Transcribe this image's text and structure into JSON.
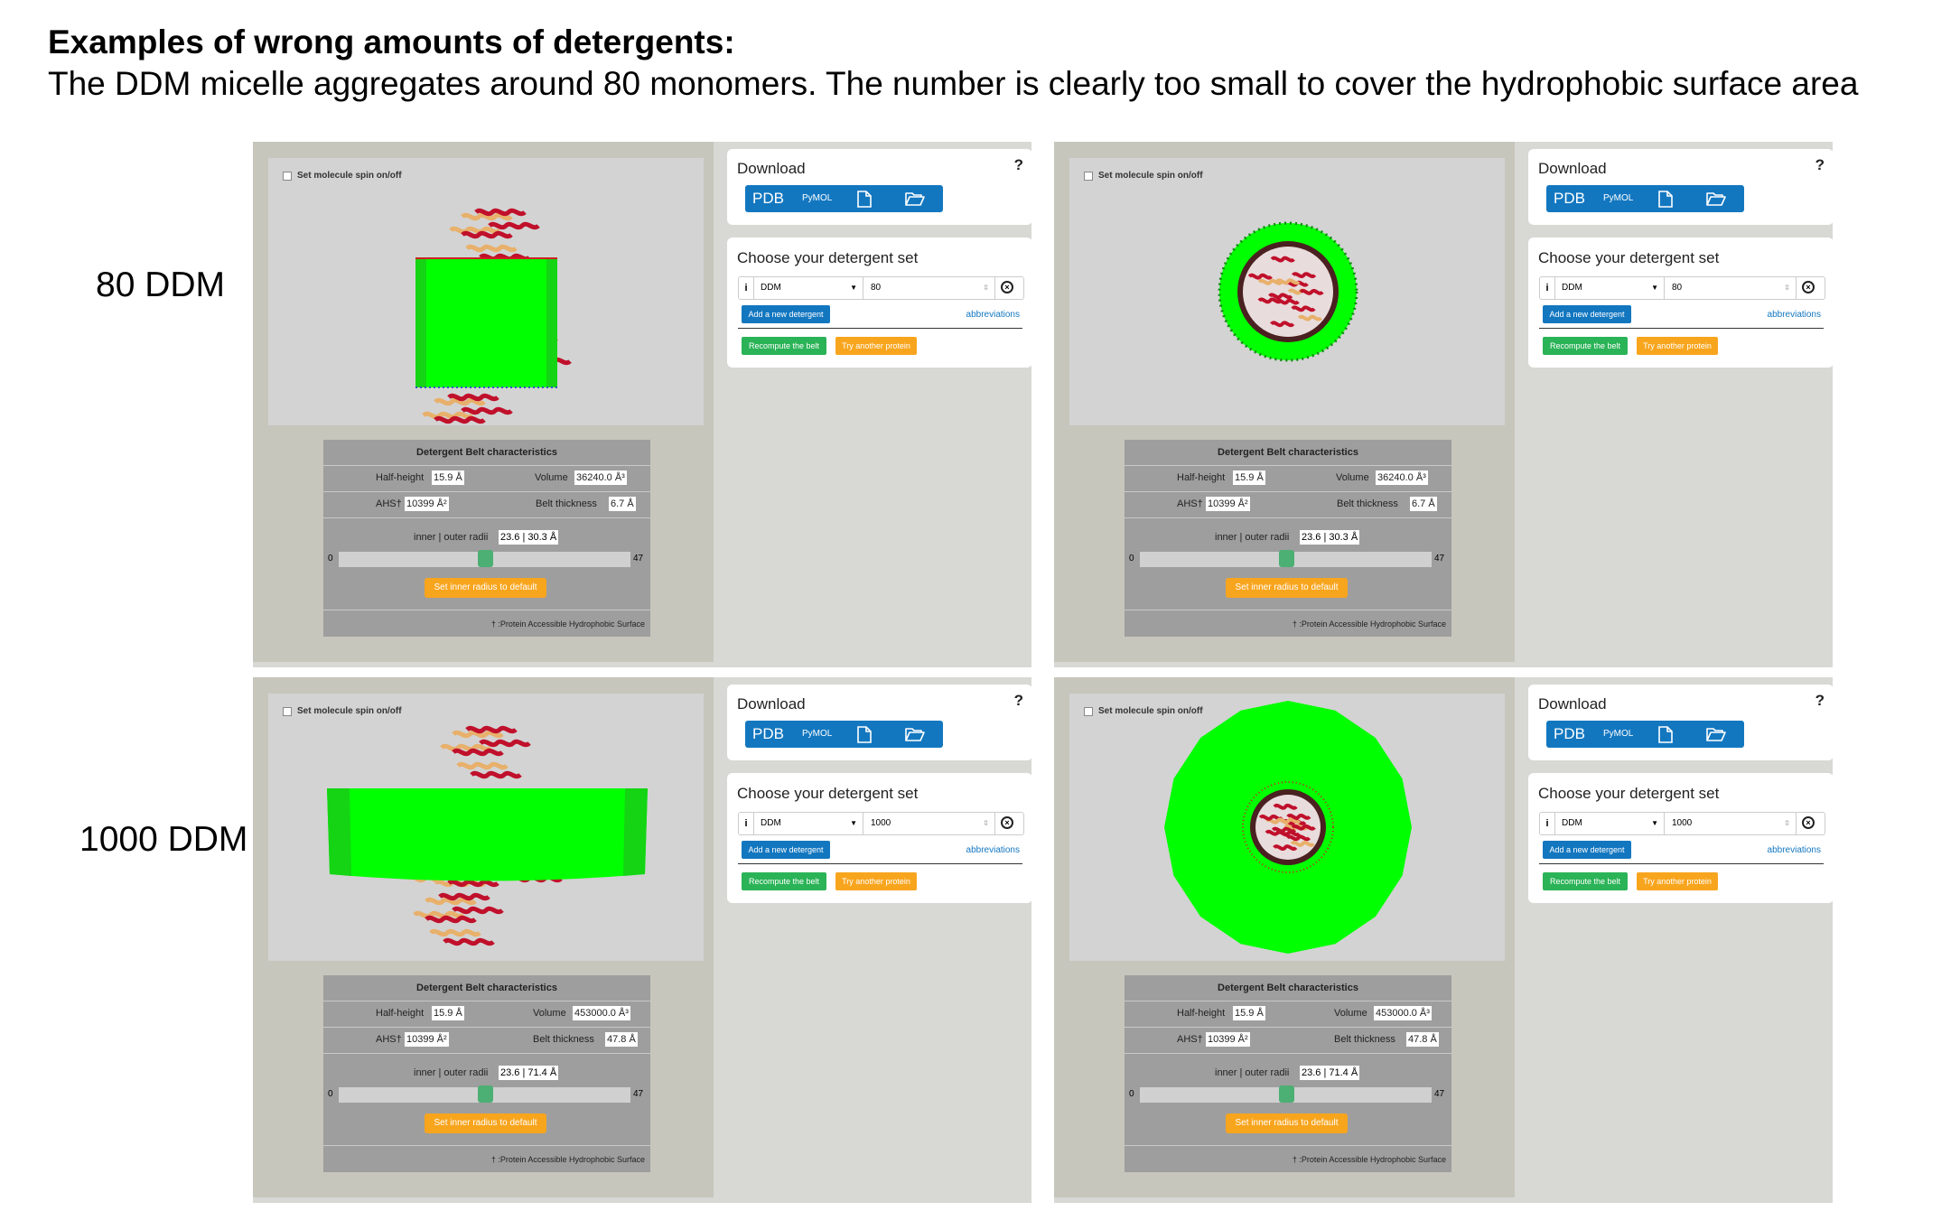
{
  "heading": "Examples of wrong amounts of detergents:",
  "subheading": "The DDM micelle aggregates around 80 monomers. The number is clearly too small to cover the hydrophobic surface area",
  "rows": [
    {
      "label": "80 DDM",
      "panels": [
        {
          "view": "side",
          "spin_label": "Set molecule spin on/off",
          "characteristics": {
            "title": "Detergent Belt characteristics",
            "half_height_label": "Half-height",
            "half_height": "15.9 Å",
            "volume_label": "Volume",
            "volume": "36240.0 Å³",
            "ahs_label": "AHS†",
            "ahs": "10399 Å²",
            "belt_thickness_label": "Belt thickness",
            "belt_thickness": "6.7 Å",
            "radii_label": "inner | outer radii",
            "radii": "23.6 | 30.3 Å",
            "slider_min": "0",
            "slider_max": "47",
            "slider_value": 23.6,
            "reset_label": "Set inner radius to default",
            "footnote": "† :Protein Accessible Hydrophobic Surface"
          },
          "download": {
            "title": "Download",
            "help": "?",
            "pdb": "PDB",
            "pymol": "PyMOL"
          },
          "choose": {
            "title": "Choose your detergent set",
            "info": "i",
            "detergent": "DDM",
            "amount": "80",
            "add_label": "Add a new detergent",
            "abbreviations": "abbreviations",
            "recompute_label": "Recompute the belt",
            "try_label": "Try another protein"
          }
        },
        {
          "view": "top",
          "spin_label": "Set molecule spin on/off",
          "characteristics": {
            "title": "Detergent Belt characteristics",
            "half_height_label": "Half-height",
            "half_height": "15.9 Å",
            "volume_label": "Volume",
            "volume": "36240.0 Å³",
            "ahs_label": "AHS†",
            "ahs": "10399 Å²",
            "belt_thickness_label": "Belt thickness",
            "belt_thickness": "6.7 Å",
            "radii_label": "inner | outer radii",
            "radii": "23.6 | 30.3 Å",
            "slider_min": "0",
            "slider_max": "47",
            "slider_value": 23.6,
            "reset_label": "Set inner radius to default",
            "footnote": "† :Protein Accessible Hydrophobic Surface"
          },
          "download": {
            "title": "Download",
            "help": "?",
            "pdb": "PDB",
            "pymol": "PyMOL"
          },
          "choose": {
            "title": "Choose your detergent set",
            "info": "i",
            "detergent": "DDM",
            "amount": "80",
            "add_label": "Add a new detergent",
            "abbreviations": "abbreviations",
            "recompute_label": "Recompute the belt",
            "try_label": "Try another protein"
          }
        }
      ]
    },
    {
      "label": "1000 DDM",
      "panels": [
        {
          "view": "side",
          "spin_label": "Set molecule spin on/off",
          "characteristics": {
            "title": "Detergent Belt characteristics",
            "half_height_label": "Half-height",
            "half_height": "15.9 Å",
            "volume_label": "Volume",
            "volume": "453000.0 Å³",
            "ahs_label": "AHS†",
            "ahs": "10399 Å²",
            "belt_thickness_label": "Belt thickness",
            "belt_thickness": "47.8 Å",
            "radii_label": "inner | outer radii",
            "radii": "23.6 | 71.4 Å",
            "slider_min": "0",
            "slider_max": "47",
            "slider_value": 23.6,
            "reset_label": "Set inner radius to default",
            "footnote": "† :Protein Accessible Hydrophobic Surface"
          },
          "download": {
            "title": "Download",
            "help": "?",
            "pdb": "PDB",
            "pymol": "PyMOL"
          },
          "choose": {
            "title": "Choose your detergent set",
            "info": "i",
            "detergent": "DDM",
            "amount": "1000",
            "add_label": "Add a new detergent",
            "abbreviations": "abbreviations",
            "recompute_label": "Recompute the belt",
            "try_label": "Try another protein"
          }
        },
        {
          "view": "top",
          "spin_label": "Set molecule spin on/off",
          "characteristics": {
            "title": "Detergent Belt characteristics",
            "half_height_label": "Half-height",
            "half_height": "15.9 Å",
            "volume_label": "Volume",
            "volume": "453000.0 Å³",
            "ahs_label": "AHS†",
            "ahs": "10399 Å²",
            "belt_thickness_label": "Belt thickness",
            "belt_thickness": "47.8 Å",
            "radii_label": "inner | outer radii",
            "radii": "23.6 | 71.4 Å",
            "slider_min": "0",
            "slider_max": "47",
            "slider_value": 23.6,
            "reset_label": "Set inner radius to default",
            "footnote": "† :Protein Accessible Hydrophobic Surface"
          },
          "download": {
            "title": "Download",
            "help": "?",
            "pdb": "PDB",
            "pymol": "PyMOL"
          },
          "choose": {
            "title": "Choose your detergent set",
            "info": "i",
            "detergent": "DDM",
            "amount": "1000",
            "add_label": "Add a new detergent",
            "abbreviations": "abbreviations",
            "recompute_label": "Recompute the belt",
            "try_label": "Try another protein"
          }
        }
      ]
    }
  ],
  "colors": {
    "belt": "#00ff00",
    "protein_red": "#c0102b",
    "protein_tan": "#e8b06a",
    "primary": "#1377c0",
    "success": "#2bb357",
    "warning": "#f8a51e"
  }
}
